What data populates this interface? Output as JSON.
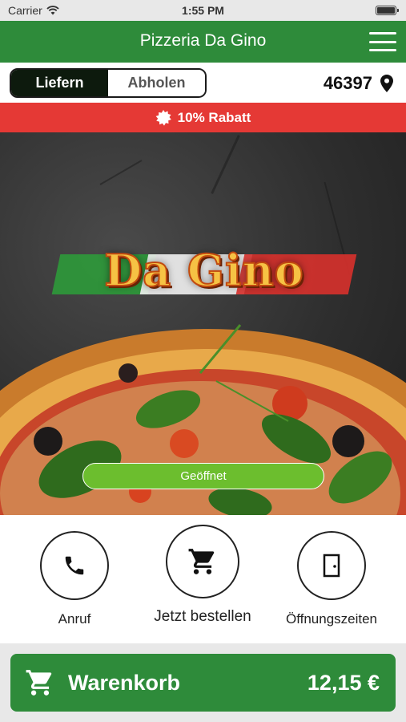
{
  "status_bar": {
    "carrier": "Carrier",
    "time": "1:55 PM"
  },
  "header": {
    "title": "Pizzeria Da Gino"
  },
  "order_mode": {
    "options": [
      "Liefern",
      "Abholen"
    ],
    "selected": "Liefern"
  },
  "location": {
    "zip": "46397"
  },
  "discount": {
    "text": "10% Rabatt"
  },
  "hero": {
    "logo_text": "Da Gino",
    "status": "Geöffnet"
  },
  "actions": [
    {
      "label": "Anruf",
      "icon": "phone-icon"
    },
    {
      "label": "Jetzt bestellen",
      "icon": "cart-icon"
    },
    {
      "label": "Öffnungszeiten",
      "icon": "door-icon"
    }
  ],
  "cart": {
    "label": "Warenkorb",
    "total": "12,15 €"
  },
  "colors": {
    "primary": "#2e8b3a",
    "discount": "#e53935",
    "open": "#6cbe2e"
  }
}
